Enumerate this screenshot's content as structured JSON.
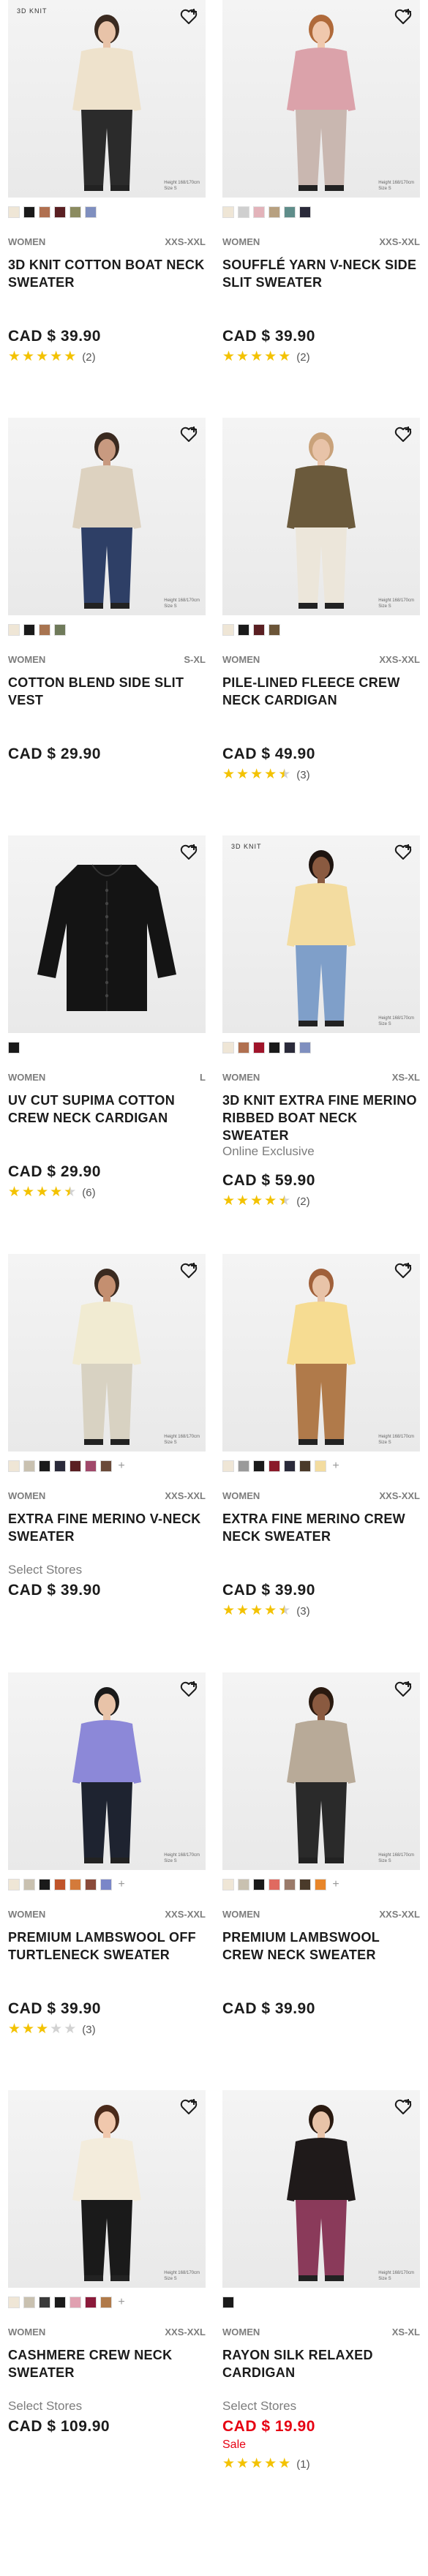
{
  "colors": {
    "star": "#f3c200",
    "sale": "#e60012",
    "meta": "#7d7d7d"
  },
  "products": [
    {
      "tag": "3D KNIT",
      "hint1": "Height 168/170cm",
      "hint2": "Size S",
      "swatches": [
        "#efe6d6",
        "#1a1a1a",
        "#b07050",
        "#5a1f22",
        "#8b8b60",
        "#7f8fbf"
      ],
      "more": false,
      "gender": "WOMEN",
      "sizes": "XXS-XXL",
      "name": "3D KNIT COTTON BOAT NECK SWEATER",
      "flag": "",
      "price": "CAD $ 39.90",
      "sale_label": "",
      "stars": 5,
      "count": "(2)",
      "look": {
        "skin": "#e8c3a8",
        "top": "#eee2cc",
        "bottom": "#2b2b2b",
        "hair": "#3a2a20"
      }
    },
    {
      "tag": "",
      "hint1": "Height 168/170cm",
      "hint2": "Size S",
      "swatches": [
        "#efe6d6",
        "#cfcfcf",
        "#e3b3ba",
        "#b7a080",
        "#5f8d8a",
        "#2a2a3a"
      ],
      "more": false,
      "gender": "WOMEN",
      "sizes": "XXS-XXL",
      "name": "SOUFFLÉ YARN V-NECK SIDE SLIT SWEATER",
      "flag": "",
      "price": "CAD $ 39.90",
      "sale_label": "",
      "stars": 5,
      "count": "(2)",
      "look": {
        "skin": "#f0c8ad",
        "top": "#dba2aa",
        "bottom": "#c9b7b0",
        "hair": "#b06a3a"
      }
    },
    {
      "tag": "",
      "hint1": "Height 168/170cm",
      "hint2": "Size S",
      "swatches": [
        "#efe6d6",
        "#1a1a1a",
        "#a87450",
        "#6f7a5a"
      ],
      "more": false,
      "gender": "WOMEN",
      "sizes": "S-XL",
      "name": "COTTON BLEND SIDE SLIT VEST",
      "flag": "",
      "price": "CAD $ 29.90",
      "sale_label": "",
      "stars": 0,
      "count": "",
      "look": {
        "skin": "#c89a80",
        "top": "#ddd2c0",
        "bottom": "#2e3f66",
        "hair": "#3a2a20"
      }
    },
    {
      "tag": "",
      "hint1": "Height 168/170cm",
      "hint2": "Size S",
      "swatches": [
        "#efe6d6",
        "#1a1a1a",
        "#5a1f22",
        "#6b5538"
      ],
      "more": false,
      "gender": "WOMEN",
      "sizes": "XXS-XXL",
      "name": "PILE-LINED FLEECE CREW NECK CARDIGAN",
      "flag": "",
      "price": "CAD $ 49.90",
      "sale_label": "",
      "stars": 4.5,
      "count": "(3)",
      "look": {
        "skin": "#e8c3a8",
        "top": "#6b5a3c",
        "bottom": "#ece6da",
        "hair": "#c9a27a"
      }
    },
    {
      "tag": "",
      "hint1": "",
      "hint2": "",
      "swatches": [
        "#1a1a1a"
      ],
      "more": false,
      "gender": "WOMEN",
      "sizes": "L",
      "name": "UV CUT SUPIMA COTTON CREW NECK CARDIGAN",
      "flag": "",
      "price": "CAD $ 29.90",
      "sale_label": "",
      "stars": 4.5,
      "count": "(6)",
      "look": {
        "skin": "",
        "top": "#141414",
        "bottom": "",
        "hair": ""
      }
    },
    {
      "tag": "3D KNIT",
      "hint1": "Height 168/170cm",
      "hint2": "Size S",
      "swatches": [
        "#efe6d6",
        "#b07050",
        "#a0142a",
        "#1a1a1a",
        "#2a2a3a",
        "#7f8fbf"
      ],
      "more": false,
      "gender": "WOMEN",
      "sizes": "XS-XL",
      "name": "3D KNIT EXTRA FINE MERINO RIBBED BOAT NECK SWEATER",
      "flag": "Online Exclusive",
      "price": "CAD $ 59.90",
      "sale_label": "",
      "stars": 4.5,
      "count": "(2)",
      "look": {
        "skin": "#8a5a40",
        "top": "#f3dca0",
        "bottom": "#7f9fc9",
        "hair": "#1e1410"
      }
    },
    {
      "tag": "",
      "hint1": "Height 168/170cm",
      "hint2": "Size S",
      "swatches": [
        "#efe6d6",
        "#c9c1b0",
        "#1a1a1a",
        "#2a2a3a",
        "#5a1f22",
        "#a0486a",
        "#6a4a3a"
      ],
      "more": true,
      "gender": "WOMEN",
      "sizes": "XXS-XXL",
      "name": "EXTRA FINE MERINO V-NECK SWEATER",
      "flag": "Select Stores",
      "price": "CAD $ 39.90",
      "sale_label": "",
      "stars": 0,
      "count": "",
      "look": {
        "skin": "#c48f70",
        "top": "#f1ebd2",
        "bottom": "#d8d2c2",
        "hair": "#3a2a20"
      }
    },
    {
      "tag": "",
      "hint1": "Height 168/170cm",
      "hint2": "Size S",
      "swatches": [
        "#efe6d6",
        "#9a9a9a",
        "#1a1a1a",
        "#8a1a2a",
        "#2a2a3a",
        "#4a3a2a",
        "#f3dca0"
      ],
      "more": true,
      "gender": "WOMEN",
      "sizes": "XXS-XXL",
      "name": "EXTRA FINE MERINO CREW NECK SWEATER",
      "flag": "",
      "price": "CAD $ 39.90",
      "sale_label": "",
      "stars": 4.5,
      "count": "(3)",
      "look": {
        "skin": "#e8c3a8",
        "top": "#f6dc92",
        "bottom": "#b07a4a",
        "hair": "#a0603a"
      }
    },
    {
      "tag": "",
      "hint1": "Height 168/170cm",
      "hint2": "Size S",
      "swatches": [
        "#efe6d6",
        "#c9c1b0",
        "#1a1a1a",
        "#c0542a",
        "#d47a3a",
        "#8a4a3a",
        "#7a86c8"
      ],
      "more": true,
      "gender": "WOMEN",
      "sizes": "XXS-XXL",
      "name": "PREMIUM LAMBSWOOL OFF TURTLENECK SWEATER",
      "flag": "",
      "price": "CAD $ 39.90",
      "sale_label": "",
      "stars": 3,
      "count": "(3)",
      "look": {
        "skin": "#e8c3a8",
        "top": "#8c88d8",
        "bottom": "#1e2330",
        "hair": "#1a1a1a"
      }
    },
    {
      "tag": "",
      "hint1": "Height 168/170cm",
      "hint2": "Size S",
      "swatches": [
        "#efe6d6",
        "#c9c1b0",
        "#1a1a1a",
        "#e06a60",
        "#9a7a6a",
        "#4a3a2a",
        "#e8862a"
      ],
      "more": true,
      "gender": "WOMEN",
      "sizes": "XXS-XXL",
      "name": "PREMIUM LAMBSWOOL CREW NECK SWEATER",
      "flag": "",
      "price": "CAD $ 39.90",
      "sale_label": "",
      "stars": 0,
      "count": "",
      "look": {
        "skin": "#8a5a40",
        "top": "#b8aa98",
        "bottom": "#2a2a2a",
        "hair": "#2a1a10"
      }
    },
    {
      "tag": "",
      "hint1": "Height 168/170cm",
      "hint2": "Size S",
      "swatches": [
        "#efe6d6",
        "#c9c1b0",
        "#3a3a3a",
        "#1a1a1a",
        "#e0a0b0",
        "#8a1a3a",
        "#b07a4a"
      ],
      "more": true,
      "gender": "WOMEN",
      "sizes": "XXS-XXL",
      "name": "CASHMERE CREW NECK SWEATER",
      "flag": "Select Stores",
      "price": "CAD $ 109.90",
      "sale_label": "",
      "stars": 0,
      "count": "",
      "look": {
        "skin": "#f0c8ad",
        "top": "#f3ecdc",
        "bottom": "#1a1a1a",
        "hair": "#4a2a1a"
      }
    },
    {
      "tag": "",
      "hint1": "Height 168/170cm",
      "hint2": "Size S",
      "swatches": [
        "#1a1a1a"
      ],
      "more": false,
      "gender": "WOMEN",
      "sizes": "XS-XL",
      "name": "RAYON SILK RELAXED CARDIGAN",
      "flag": "Select Stores",
      "price": "CAD $ 19.90",
      "sale_label": "Sale",
      "stars": 5,
      "count": "(1)",
      "look": {
        "skin": "#e8c3a8",
        "top": "#1f1a1a",
        "bottom": "#8a3a5a",
        "hair": "#2a1a10"
      }
    }
  ]
}
